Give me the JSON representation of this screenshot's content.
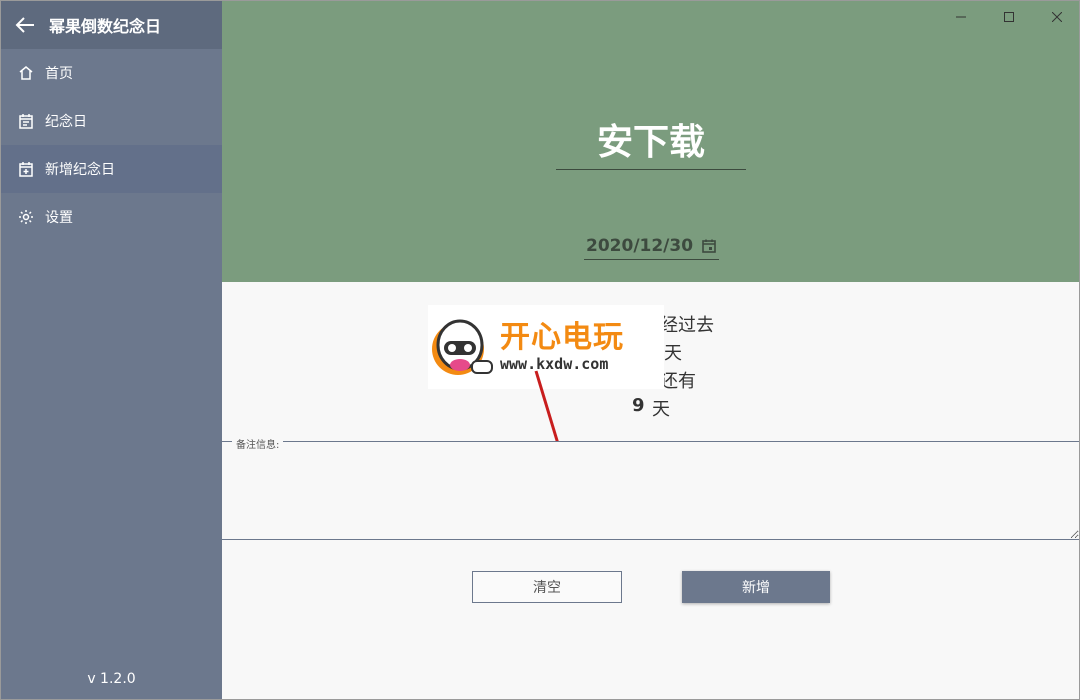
{
  "app": {
    "title": "幂果倒数纪念日",
    "version": "v 1.2.0"
  },
  "sidebar": {
    "items": [
      {
        "label": "首页",
        "icon": "home-icon"
      },
      {
        "label": "纪念日",
        "icon": "calendar-list-icon"
      },
      {
        "label": "新增纪念日",
        "icon": "calendar-add-icon"
      },
      {
        "label": "设置",
        "icon": "gear-icon"
      }
    ]
  },
  "event": {
    "title": "安下载",
    "date": "2020/12/30"
  },
  "countdown": {
    "passed_suffix": "经过去",
    "passed_unit": "天",
    "remaining_suffix": "还有",
    "days": "9",
    "unit": "天"
  },
  "watermark": {
    "brand": "开心电玩",
    "url": "www.kxdw.com"
  },
  "notes": {
    "label": "备注信息:",
    "value": ""
  },
  "buttons": {
    "clear": "清空",
    "add": "新增"
  },
  "colors": {
    "sidebar": "#6c788d",
    "hero": "#7b9c7e",
    "accent": "#6c788d",
    "arrow": "#d02020"
  }
}
